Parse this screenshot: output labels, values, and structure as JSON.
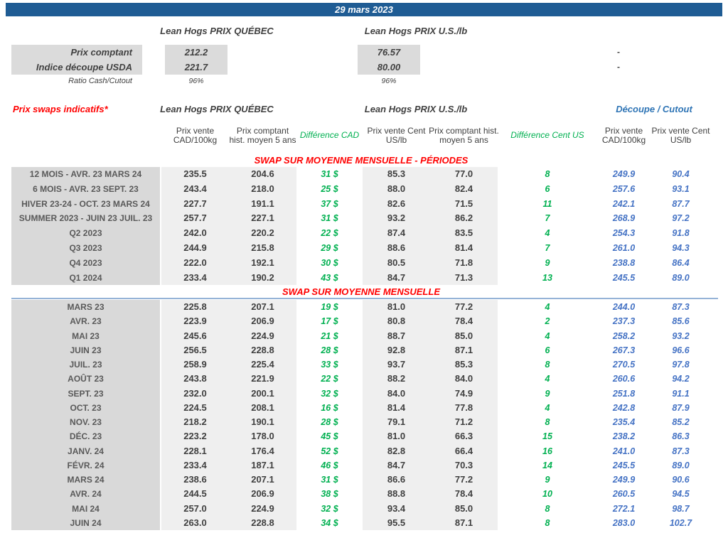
{
  "title_bar": {
    "date": "29 mars 2023"
  },
  "colors": {
    "title_bar_bg": "#1F5C94",
    "red": "#FF0000",
    "green": "#00B050",
    "blue_values": "#4472C4",
    "blue_header": "#2E74B5",
    "label_col_bg": "#D9D9D9",
    "value_col_bg": "#EFEFEF",
    "divider": "#95B3D7"
  },
  "spot": {
    "quebec_header": "Lean Hogs PRIX QUÉBEC",
    "us_header": "Lean Hogs PRIX U.S./lb",
    "rows": [
      {
        "label": "Prix comptant",
        "quebec": "212.2",
        "us": "76.57",
        "right": "-"
      },
      {
        "label": "Indice découpe USDA",
        "quebec": "221.7",
        "us": "80.00",
        "right": "-"
      },
      {
        "label": "Ratio Cash/Cutout",
        "quebec": "96%",
        "us": "96%",
        "right": ""
      }
    ]
  },
  "swaps": {
    "title": "Prix swaps indicatifs*",
    "group_headers": {
      "quebec": "Lean Hogs PRIX QUÉBEC",
      "us": "Lean Hogs PRIX U.S./lb",
      "cutout": "Découpe / Cutout"
    },
    "column_headers": [
      "Prix vente CAD/100kg",
      "Prix comptant hist. moyen 5 ans",
      "Différence CAD",
      "Prix vente Cent US/lb",
      "Prix comptant hist. moyen 5 ans",
      "Différence Cent US",
      "Prix vente CAD/100kg",
      "Prix vente Cent US/lb"
    ],
    "sections": [
      {
        "title": "SWAP SUR MOYENNE MENSUELLE - PÉRIODES",
        "rows": [
          {
            "label": "12 MOIS - AVR. 23 MARS 24",
            "pv_cad": "235.5",
            "hist_cad": "204.6",
            "diff_cad": "31 $",
            "pv_us": "85.3",
            "hist_us": "77.0",
            "diff_us": "8",
            "cutout_cad": "249.9",
            "cutout_us": "90.4"
          },
          {
            "label": "6 MOIS - AVR. 23 SEPT. 23",
            "pv_cad": "243.4",
            "hist_cad": "218.0",
            "diff_cad": "25 $",
            "pv_us": "88.0",
            "hist_us": "82.4",
            "diff_us": "6",
            "cutout_cad": "257.6",
            "cutout_us": "93.1"
          },
          {
            "label": "HIVER 23-24 -  OCT. 23 MARS 24",
            "pv_cad": "227.7",
            "hist_cad": "191.1",
            "diff_cad": "37 $",
            "pv_us": "82.6",
            "hist_us": "71.5",
            "diff_us": "11",
            "cutout_cad": "242.1",
            "cutout_us": "87.7"
          },
          {
            "label": "SUMMER 2023 - JUIN 23 JUIL. 23",
            "pv_cad": "257.7",
            "hist_cad": "227.1",
            "diff_cad": "31 $",
            "pv_us": "93.2",
            "hist_us": "86.2",
            "diff_us": "7",
            "cutout_cad": "268.9",
            "cutout_us": "97.2"
          },
          {
            "label": "Q2 2023",
            "pv_cad": "242.0",
            "hist_cad": "220.2",
            "diff_cad": "22 $",
            "pv_us": "87.4",
            "hist_us": "83.5",
            "diff_us": "4",
            "cutout_cad": "254.3",
            "cutout_us": "91.8"
          },
          {
            "label": "Q3 2023",
            "pv_cad": "244.9",
            "hist_cad": "215.8",
            "diff_cad": "29 $",
            "pv_us": "88.6",
            "hist_us": "81.4",
            "diff_us": "7",
            "cutout_cad": "261.0",
            "cutout_us": "94.3"
          },
          {
            "label": "Q4 2023",
            "pv_cad": "222.0",
            "hist_cad": "192.1",
            "diff_cad": "30 $",
            "pv_us": "80.5",
            "hist_us": "71.8",
            "diff_us": "9",
            "cutout_cad": "238.8",
            "cutout_us": "86.4"
          },
          {
            "label": "Q1 2024",
            "pv_cad": "233.4",
            "hist_cad": "190.2",
            "diff_cad": "43 $",
            "pv_us": "84.7",
            "hist_us": "71.3",
            "diff_us": "13",
            "cutout_cad": "245.5",
            "cutout_us": "89.0"
          }
        ]
      },
      {
        "title": "SWAP SUR MOYENNE MENSUELLE",
        "rows": [
          {
            "label": "MARS 23",
            "pv_cad": "225.8",
            "hist_cad": "207.1",
            "diff_cad": "19 $",
            "pv_us": "81.0",
            "hist_us": "77.2",
            "diff_us": "4",
            "cutout_cad": "244.0",
            "cutout_us": "87.3"
          },
          {
            "label": "AVR. 23",
            "pv_cad": "223.9",
            "hist_cad": "206.9",
            "diff_cad": "17 $",
            "pv_us": "80.8",
            "hist_us": "78.4",
            "diff_us": "2",
            "cutout_cad": "237.3",
            "cutout_us": "85.6"
          },
          {
            "label": "MAI 23",
            "pv_cad": "245.6",
            "hist_cad": "224.9",
            "diff_cad": "21 $",
            "pv_us": "88.7",
            "hist_us": "85.0",
            "diff_us": "4",
            "cutout_cad": "258.2",
            "cutout_us": "93.2"
          },
          {
            "label": "JUIN 23",
            "pv_cad": "256.5",
            "hist_cad": "228.8",
            "diff_cad": "28 $",
            "pv_us": "92.8",
            "hist_us": "87.1",
            "diff_us": "6",
            "cutout_cad": "267.3",
            "cutout_us": "96.6"
          },
          {
            "label": "JUIL. 23",
            "pv_cad": "258.9",
            "hist_cad": "225.4",
            "diff_cad": "33 $",
            "pv_us": "93.7",
            "hist_us": "85.3",
            "diff_us": "8",
            "cutout_cad": "270.5",
            "cutout_us": "97.8"
          },
          {
            "label": "AOÛT 23",
            "pv_cad": "243.8",
            "hist_cad": "221.9",
            "diff_cad": "22 $",
            "pv_us": "88.2",
            "hist_us": "84.0",
            "diff_us": "4",
            "cutout_cad": "260.6",
            "cutout_us": "94.2"
          },
          {
            "label": "SEPT. 23",
            "pv_cad": "232.0",
            "hist_cad": "200.1",
            "diff_cad": "32 $",
            "pv_us": "84.0",
            "hist_us": "74.9",
            "diff_us": "9",
            "cutout_cad": "251.8",
            "cutout_us": "91.1"
          },
          {
            "label": "OCT. 23",
            "pv_cad": "224.5",
            "hist_cad": "208.1",
            "diff_cad": "16 $",
            "pv_us": "81.4",
            "hist_us": "77.8",
            "diff_us": "4",
            "cutout_cad": "242.8",
            "cutout_us": "87.9"
          },
          {
            "label": "NOV. 23",
            "pv_cad": "218.2",
            "hist_cad": "190.1",
            "diff_cad": "28 $",
            "pv_us": "79.1",
            "hist_us": "71.2",
            "diff_us": "8",
            "cutout_cad": "235.4",
            "cutout_us": "85.2"
          },
          {
            "label": "DÉC. 23",
            "pv_cad": "223.2",
            "hist_cad": "178.0",
            "diff_cad": "45 $",
            "pv_us": "81.0",
            "hist_us": "66.3",
            "diff_us": "15",
            "cutout_cad": "238.2",
            "cutout_us": "86.3"
          },
          {
            "label": "JANV. 24",
            "pv_cad": "228.1",
            "hist_cad": "176.4",
            "diff_cad": "52 $",
            "pv_us": "82.8",
            "hist_us": "66.4",
            "diff_us": "16",
            "cutout_cad": "241.0",
            "cutout_us": "87.3"
          },
          {
            "label": "FÉVR. 24",
            "pv_cad": "233.4",
            "hist_cad": "187.1",
            "diff_cad": "46 $",
            "pv_us": "84.7",
            "hist_us": "70.3",
            "diff_us": "14",
            "cutout_cad": "245.5",
            "cutout_us": "89.0"
          },
          {
            "label": "MARS 24",
            "pv_cad": "238.6",
            "hist_cad": "207.1",
            "diff_cad": "31 $",
            "pv_us": "86.6",
            "hist_us": "77.2",
            "diff_us": "9",
            "cutout_cad": "249.9",
            "cutout_us": "90.6"
          },
          {
            "label": "AVR. 24",
            "pv_cad": "244.5",
            "hist_cad": "206.9",
            "diff_cad": "38 $",
            "pv_us": "88.8",
            "hist_us": "78.4",
            "diff_us": "10",
            "cutout_cad": "260.5",
            "cutout_us": "94.5"
          },
          {
            "label": "MAI 24",
            "pv_cad": "257.0",
            "hist_cad": "224.9",
            "diff_cad": "32 $",
            "pv_us": "93.4",
            "hist_us": "85.0",
            "diff_us": "8",
            "cutout_cad": "272.1",
            "cutout_us": "98.7"
          },
          {
            "label": "JUIN 24",
            "pv_cad": "263.0",
            "hist_cad": "228.8",
            "diff_cad": "34 $",
            "pv_us": "95.5",
            "hist_us": "87.1",
            "diff_us": "8",
            "cutout_cad": "283.0",
            "cutout_us": "102.7"
          }
        ]
      }
    ]
  }
}
